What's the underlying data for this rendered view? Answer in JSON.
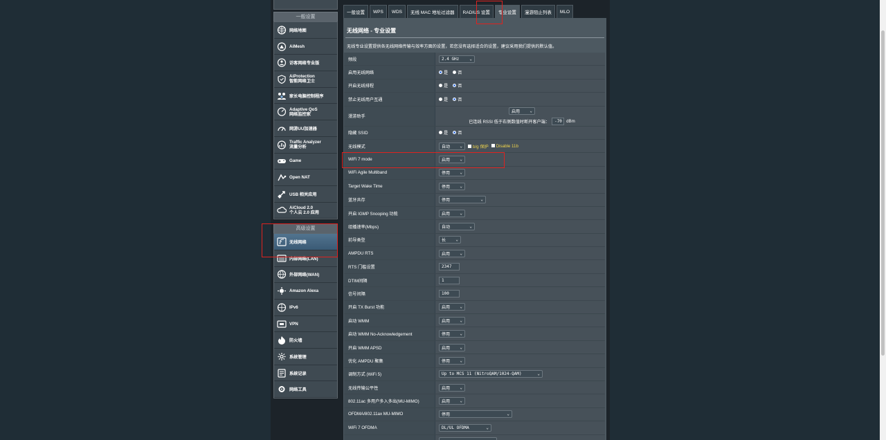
{
  "sidebar": {
    "general_header": "一般设置",
    "general_items": [
      {
        "label": "网络地图",
        "icon": "globe-icon"
      },
      {
        "label": "AiMesh",
        "icon": "mesh-icon"
      },
      {
        "label": "访客网络专业版",
        "icon": "guest-network-icon"
      },
      {
        "label": "AiProtection",
        "label2": "智能网络卫士",
        "icon": "shield-icon"
      },
      {
        "label": "家长电脑控制程序",
        "icon": "family-icon"
      },
      {
        "label": "Adaptive QoS",
        "label2": "网络监控家",
        "icon": "qos-icon"
      },
      {
        "label": "网游UU加速器",
        "icon": "speedometer-icon"
      },
      {
        "label": "Traffic Analyzer",
        "label2": "流量分析",
        "icon": "traffic-icon"
      },
      {
        "label": "Game",
        "icon": "gamepad-icon"
      },
      {
        "label": "Open NAT",
        "icon": "nat-icon"
      },
      {
        "label": "USB 相关应用",
        "icon": "usb-icon"
      },
      {
        "label": "AiCloud 2.0",
        "label2": "个人云 2.0 应用",
        "icon": "cloud-icon"
      }
    ],
    "advanced_header": "高级设置",
    "advanced_items": [
      {
        "label": "无线网络",
        "icon": "wireless-icon"
      },
      {
        "label": "内部网络(LAN)",
        "icon": "lan-icon"
      },
      {
        "label": "外部网络(WAN)",
        "icon": "wan-icon"
      },
      {
        "label": "Amazon Alexa",
        "icon": "alexa-icon"
      },
      {
        "label": "IPv6",
        "icon": "ipv6-icon"
      },
      {
        "label": "VPN",
        "icon": "vpn-icon"
      },
      {
        "label": "防火墙",
        "icon": "firewall-icon"
      },
      {
        "label": "系统管理",
        "icon": "admin-icon"
      },
      {
        "label": "系统记录",
        "icon": "log-icon"
      },
      {
        "label": "网络工具",
        "icon": "tools-icon"
      }
    ]
  },
  "tabs": [
    "一般设置",
    "WPS",
    "WDS",
    "无线 MAC 地址过滤器",
    "RADIUS 设置",
    "专业设置",
    "漫游阻止列表",
    "MLO"
  ],
  "page": {
    "title": "无线网络 - 专业设置",
    "description": "无线专业设置提供各无线网络传输与效率方面的设置，若您没有选择适合的设置，建议采用我们提供的默认值。"
  },
  "rows": [
    {
      "label": "频段",
      "type": "select",
      "value": "2.4 GHz",
      "w": 40
    },
    {
      "label": "启用无线网络",
      "type": "radio",
      "options": [
        "是",
        "否"
      ],
      "selected": 0
    },
    {
      "label": "开启无线排程",
      "type": "radio",
      "options": [
        "是",
        "否"
      ],
      "selected": 1
    },
    {
      "label": "禁止无线用户互通",
      "type": "radio",
      "options": [
        "是",
        "否"
      ],
      "selected": 1
    },
    {
      "label": "漫游助手",
      "type": "roaming",
      "value": "启用",
      "sub": "已连线 RSSI 低于右侧数值时断开客户端：",
      "rssi": "-70",
      "unit": "dBm"
    },
    {
      "label": "隐藏 SSID",
      "type": "radio",
      "options": [
        "是",
        "否"
      ],
      "selected": 1
    },
    {
      "label": "无线模式",
      "type": "mode",
      "value": "自动",
      "cb1": "b/g 保护",
      "cb2": "Disable 11b"
    },
    {
      "label": "WiFi 7 mode",
      "type": "select",
      "value": "启用",
      "w": 26
    },
    {
      "label": "WiFi Agile Multiband",
      "type": "select",
      "value": "停用",
      "w": 26
    },
    {
      "label": "Target Wake Time",
      "type": "select",
      "value": "停用",
      "w": 26
    },
    {
      "label": "蓝牙共存",
      "type": "select",
      "value": "停用",
      "w": 56
    },
    {
      "label": "开启 IGMP Snooping 功能",
      "type": "select",
      "value": "启用",
      "w": 26
    },
    {
      "label": "组播速率(Mbps)",
      "type": "select",
      "value": "自动",
      "w": 40
    },
    {
      "label": "前导类型",
      "type": "select",
      "value": "长",
      "w": 20
    },
    {
      "label": "AMPDU RTS",
      "type": "select",
      "value": "启用",
      "w": 26
    },
    {
      "label": "RTS 门槛设置",
      "type": "input",
      "value": "2347",
      "w": 30
    },
    {
      "label": "DTIM间隔",
      "type": "input",
      "value": "1",
      "w": 30
    },
    {
      "label": "信号间隔",
      "type": "input",
      "value": "100",
      "w": 30
    },
    {
      "label": "开启 TX Burst 功能",
      "type": "select",
      "value": "启用",
      "w": 26
    },
    {
      "label": "启动 WMM",
      "type": "select",
      "value": "启用",
      "w": 26
    },
    {
      "label": "启动 WMM No-Acknowledgement",
      "type": "select",
      "value": "停用",
      "w": 26
    },
    {
      "label": "开启 WMM APSD",
      "type": "select",
      "value": "启用",
      "w": 26
    },
    {
      "label": "优化 AMPDU 聚集",
      "type": "select",
      "value": "停用",
      "w": 26
    },
    {
      "label": "调制方式 (WiFi 5)",
      "type": "select",
      "value": "Up to MCS 11 (NitroQAM/1024-QAM)",
      "w": 138
    },
    {
      "label": "无线传输公平性",
      "type": "select",
      "value": "启用",
      "w": 26
    },
    {
      "label": "802.11ac 多用户多入多出(MU-MIMO)",
      "type": "select",
      "value": "启用",
      "w": 26
    },
    {
      "label": "OFDMA/802.11ax MU-MIMO",
      "type": "select",
      "value": "停用",
      "w": 94
    },
    {
      "label": "WiFi 7 OFDMA",
      "type": "select",
      "value": "DL/UL OFDMA",
      "w": 64
    },
    {
      "label": "",
      "type": "select",
      "value": "",
      "w": 72
    }
  ],
  "colors": {
    "highlight": "#e0221f",
    "active_nav": "#4a6d8a",
    "bg": "#1f2d36"
  }
}
